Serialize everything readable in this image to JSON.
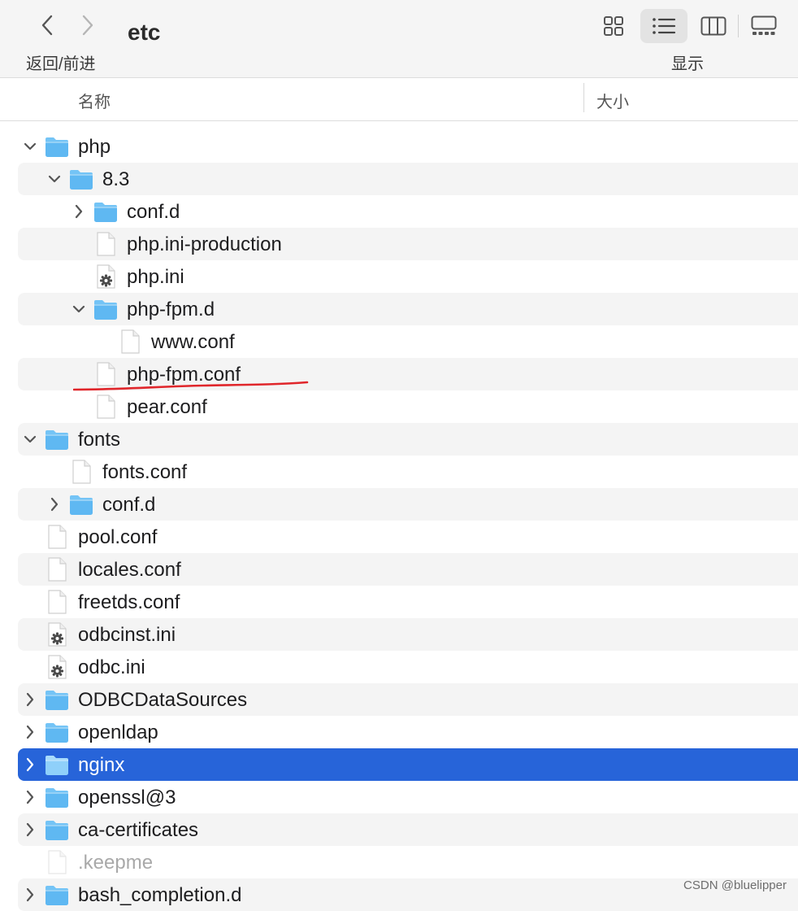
{
  "toolbar": {
    "nav_label": "返回/前进",
    "title": "etc",
    "view_label": "显示",
    "icons": [
      "chevron-left-icon",
      "chevron-right-icon",
      "icon-view-grid-icon",
      "list-view-icon",
      "column-view-icon",
      "gallery-view-icon"
    ]
  },
  "columns": {
    "name": "名称",
    "size": "大小"
  },
  "rows": [
    {
      "name": "php",
      "type": "folder",
      "level": 0,
      "disclosure": "expanded"
    },
    {
      "name": "8.3",
      "type": "folder",
      "level": 1,
      "disclosure": "expanded"
    },
    {
      "name": "conf.d",
      "type": "folder",
      "level": 2,
      "disclosure": "collapsed"
    },
    {
      "name": "php.ini-production",
      "type": "file",
      "level": 2,
      "disclosure": "none"
    },
    {
      "name": "php.ini",
      "type": "config",
      "level": 2,
      "disclosure": "none"
    },
    {
      "name": "php-fpm.d",
      "type": "folder",
      "level": 2,
      "disclosure": "expanded"
    },
    {
      "name": "www.conf",
      "type": "file",
      "level": 3,
      "disclosure": "none"
    },
    {
      "name": "php-fpm.conf",
      "type": "file",
      "level": 2,
      "disclosure": "none"
    },
    {
      "name": "pear.conf",
      "type": "file",
      "level": 2,
      "disclosure": "none"
    },
    {
      "name": "fonts",
      "type": "folder",
      "level": 0,
      "disclosure": "expanded"
    },
    {
      "name": "fonts.conf",
      "type": "file",
      "level": 1,
      "disclosure": "none"
    },
    {
      "name": "conf.d",
      "type": "folder",
      "level": 1,
      "disclosure": "collapsed"
    },
    {
      "name": "pool.conf",
      "type": "file",
      "level": 0,
      "disclosure": "none"
    },
    {
      "name": "locales.conf",
      "type": "file",
      "level": 0,
      "disclosure": "none"
    },
    {
      "name": "freetds.conf",
      "type": "file",
      "level": 0,
      "disclosure": "none"
    },
    {
      "name": "odbcinst.ini",
      "type": "config",
      "level": 0,
      "disclosure": "none"
    },
    {
      "name": "odbc.ini",
      "type": "config",
      "level": 0,
      "disclosure": "none"
    },
    {
      "name": "ODBCDataSources",
      "type": "folder",
      "level": 0,
      "disclosure": "collapsed"
    },
    {
      "name": "openldap",
      "type": "folder",
      "level": 0,
      "disclosure": "collapsed"
    },
    {
      "name": "nginx",
      "type": "folder",
      "level": 0,
      "disclosure": "collapsed",
      "selected": true
    },
    {
      "name": "openssl@3",
      "type": "folder",
      "level": 0,
      "disclosure": "collapsed"
    },
    {
      "name": "ca-certificates",
      "type": "folder",
      "level": 0,
      "disclosure": "collapsed"
    },
    {
      "name": ".keepme",
      "type": "file",
      "level": 0,
      "disclosure": "none",
      "hidden": true
    },
    {
      "name": "bash_completion.d",
      "type": "folder",
      "level": 0,
      "disclosure": "collapsed"
    }
  ],
  "annotation": {
    "target": "php-fpm.conf",
    "color": "#e0262b"
  },
  "watermark": "CSDN @bluelipper",
  "colors": {
    "selection": "#2764d9",
    "folder": "#5fb8f2",
    "stripe": "#f4f4f4"
  }
}
